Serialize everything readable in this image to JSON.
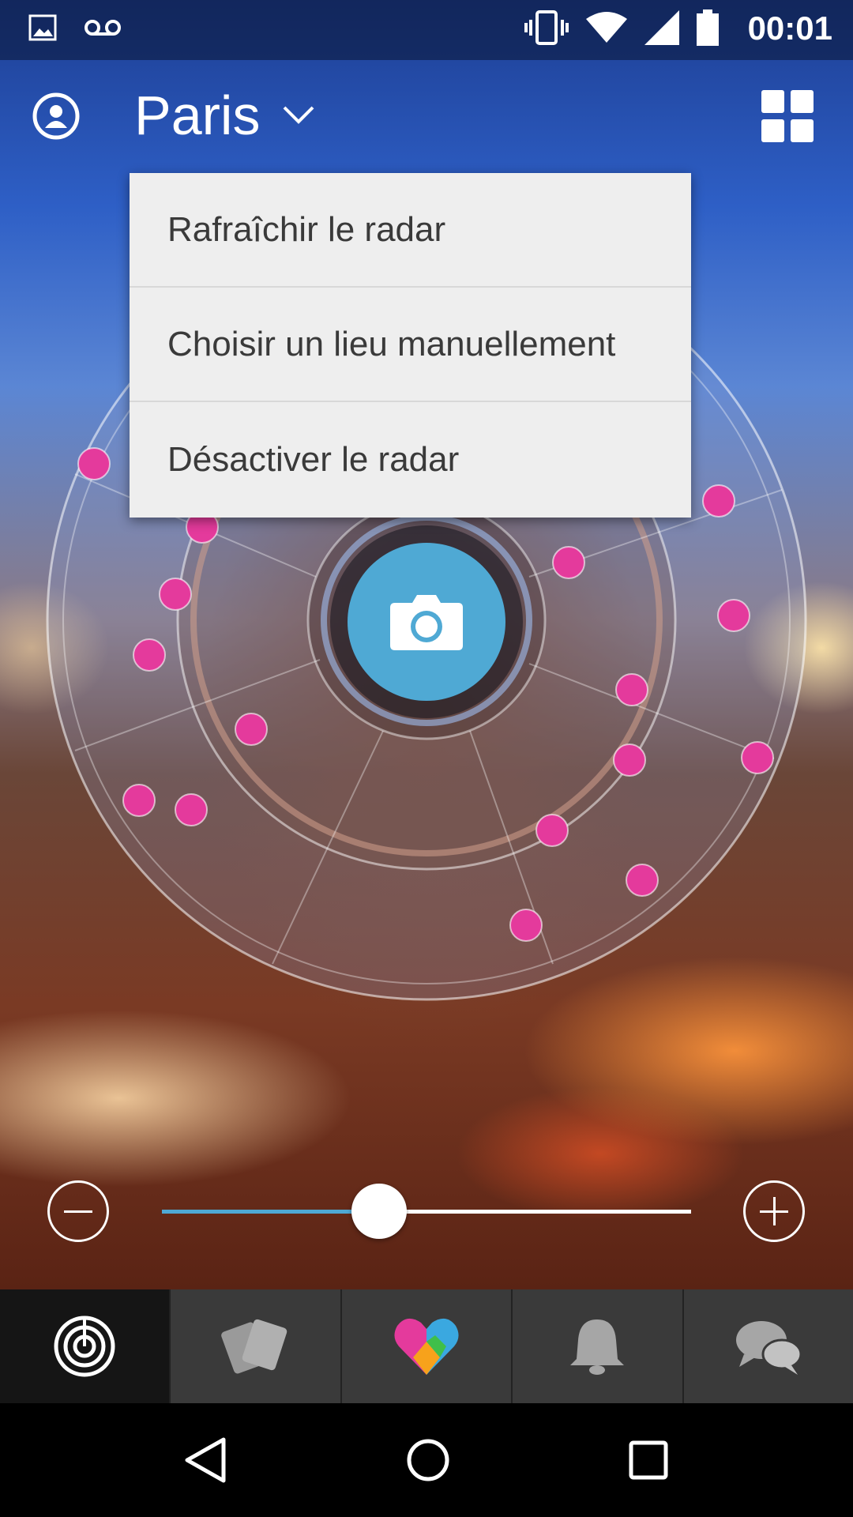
{
  "status_bar": {
    "time": "00:01",
    "icons": [
      "image-icon",
      "voicemail-icon",
      "vibrate-icon",
      "wifi-icon",
      "signal-icon",
      "battery-icon"
    ]
  },
  "header": {
    "city": "Paris",
    "profile_icon": "profile-icon",
    "grid_icon": "grid-icon"
  },
  "menu": {
    "items": [
      {
        "label": "Rafraîchir le radar"
      },
      {
        "label": "Choisir un lieu manuellement"
      },
      {
        "label": "Désactiver le radar"
      }
    ]
  },
  "zoom": {
    "level": 0.41,
    "minus_icon": "zoom-out-icon",
    "plus_icon": "zoom-in-icon"
  },
  "tabs": [
    {
      "icon": "radar-icon",
      "active": true
    },
    {
      "icon": "cards-icon",
      "active": false
    },
    {
      "icon": "heart-icon",
      "active": false
    },
    {
      "icon": "bell-icon",
      "active": false
    },
    {
      "icon": "chat-icon",
      "active": false
    }
  ],
  "nav": [
    "back-icon",
    "home-icon",
    "recents-icon"
  ],
  "colors": {
    "accent": "#4fa9d4",
    "dot": "#e43a9c",
    "menu_bg": "#eeeeee"
  }
}
